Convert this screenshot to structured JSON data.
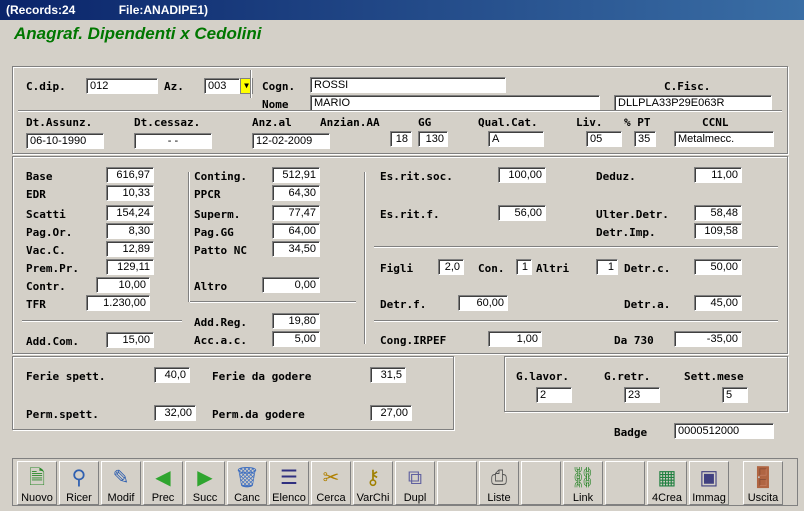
{
  "window": {
    "records": "(Records:24",
    "file": "File:ANADIPE1)"
  },
  "heading": "Anagraf. Dipendenti x Cedolini",
  "labels": {
    "cdip": "C.dip.",
    "az": "Az.",
    "cogn": "Cogn.",
    "nome": "Nome",
    "cfisc": "C.Fisc.",
    "dtassunz": "Dt.Assunz.",
    "dtcessaz": "Dt.cessaz.",
    "anzal": "Anz.al",
    "anzian": "Anzian.AA",
    "gg": "GG",
    "qualcat": "Qual.Cat.",
    "liv": "Liv.",
    "pt": "% PT",
    "ccnl": "CCNL",
    "base": "Base",
    "edr": "EDR",
    "scatti": "Scatti",
    "pagor": "Pag.Or.",
    "vacc": "Vac.C.",
    "prempr": "Prem.Pr.",
    "contr": "Contr.",
    "tfr": "TFR",
    "addcom": "Add.Com.",
    "conting": "Conting.",
    "ppcr": "PPCR",
    "superm": "Superm.",
    "paggg": "Pag.GG",
    "pattonc": "Patto NC",
    "altro": "Altro",
    "addreg": "Add.Reg.",
    "accac": "Acc.a.c.",
    "esritsoc": "Es.rit.soc.",
    "deduz": "Deduz.",
    "esritf": "Es.rit.f.",
    "ulterdetr": "Ulter.Detr.",
    "detrimp": "Detr.Imp.",
    "figli": "Figli",
    "con": "Con.",
    "altri": "Altri",
    "detrc": "Detr.c.",
    "detrf": "Detr.f.",
    "detra": "Detr.a.",
    "congirpef": "Cong.IRPEF",
    "da730": "Da 730",
    "feriespett": "Ferie spett.",
    "feriedagodere": "Ferie da godere",
    "permspett": "Perm.spett.",
    "permdagodere": "Perm.da godere",
    "glavor": "G.lavor.",
    "gretr": "G.retr.",
    "settmese": "Sett.mese",
    "badge": "Badge"
  },
  "values": {
    "cdip": "012",
    "az": "003",
    "cogn": "ROSSI",
    "nome": "MARIO",
    "cfisc": "DLLPLA33P29E063R",
    "dtassunz": "06-10-1990",
    "dtcessaz": "-   -",
    "anzal": "12-02-2009",
    "anzian": "18",
    "gg": "130",
    "qualcat": "A",
    "liv": "05",
    "pt": "35",
    "ccnl": "Metalmecc.",
    "base": "616,97",
    "edr": "10,33",
    "scatti": "154,24",
    "pagor": "8,30",
    "vacc": "12,89",
    "prempr": "129,11",
    "contr": "10,00",
    "tfr": "1.230,00",
    "addcom": "15,00",
    "conting": "512,91",
    "ppcr": "64,30",
    "superm": "77,47",
    "paggg": "64,00",
    "pattonc": "34,50",
    "altro": "0,00",
    "addreg": "19,80",
    "accac": "5,00",
    "esritsoc": "100,00",
    "deduz": "11,00",
    "esritf": "56,00",
    "ulterdetr": "58,48",
    "detrimp": "109,58",
    "figli": "2,0",
    "con": "1",
    "altri": "1",
    "detrc": "50,00",
    "detrf": "60,00",
    "detra": "45,00",
    "congirpef": "1,00",
    "da730": "-35,00",
    "feriespett": "40,0",
    "feriedagodere": "31,5",
    "permspett": "32,00",
    "permdagodere": "27,00",
    "glavor": "2",
    "gretr": "23",
    "settmese": "5",
    "badge": "0000512000"
  },
  "toolbar": [
    {
      "label": "Nuovo",
      "icon": "new-doc-icon"
    },
    {
      "label": "Ricer",
      "icon": "search-icon"
    },
    {
      "label": "Modif",
      "icon": "edit-icon"
    },
    {
      "label": "Prec",
      "icon": "arrow-left-icon"
    },
    {
      "label": "Succ",
      "icon": "arrow-right-icon"
    },
    {
      "label": "Canc",
      "icon": "trash-icon"
    },
    {
      "label": "Elenco",
      "icon": "list-icon"
    },
    {
      "label": "Cerca",
      "icon": "find-icon"
    },
    {
      "label": "VarChi",
      "icon": "keys-icon"
    },
    {
      "label": "Dupl",
      "icon": "duplicate-icon"
    },
    {
      "label": "Liste",
      "icon": "printer-icon"
    },
    {
      "label": "Link",
      "icon": "link-icon"
    },
    {
      "label": "4Crea",
      "icon": "create-icon"
    },
    {
      "label": "Immag",
      "icon": "image-card-icon"
    },
    {
      "label": "Uscita",
      "icon": "exit-door-icon"
    }
  ]
}
